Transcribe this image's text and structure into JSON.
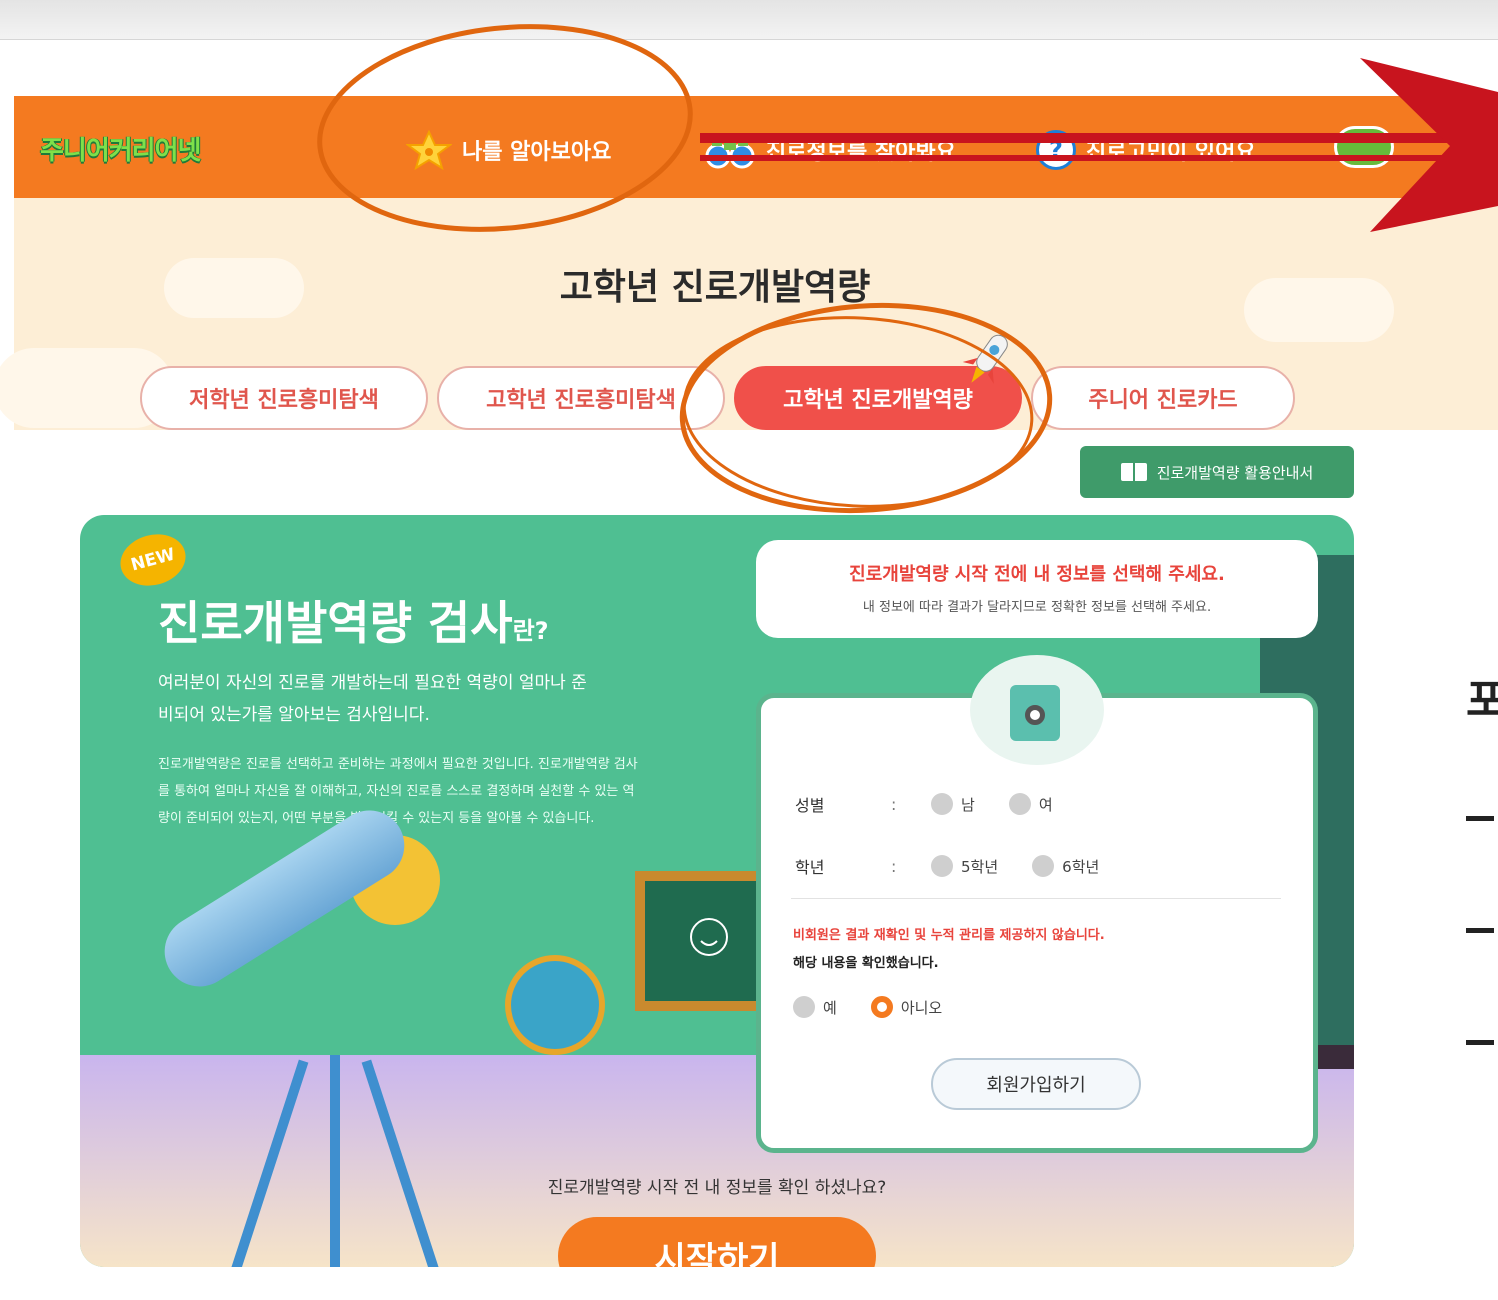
{
  "nav": {
    "logo": "주니어커리어넷",
    "items": [
      {
        "label": "나를 알아보아요",
        "icon": "star-icon"
      },
      {
        "label": "진로정보를 찾아봐요",
        "icon": "binoculars-icon"
      },
      {
        "label": "진로고민이 있어요",
        "icon": "question-icon",
        "icon_text": "?"
      }
    ]
  },
  "page_title": "고학년 진로개발역량",
  "tabs": [
    {
      "label": "저학년 진로흥미탐색",
      "active": false
    },
    {
      "label": "고학년 진로흥미탐색",
      "active": false
    },
    {
      "label": "고학년 진로개발역량",
      "active": true
    },
    {
      "label": "주니어 진로카드",
      "active": false
    }
  ],
  "guide_button": "진로개발역량 활용안내서",
  "intro": {
    "badge": "NEW",
    "title": "진로개발역량 검사",
    "title_suffix": "란?",
    "lead": "여러분이 자신의 진로를 개발하는데 필요한 역량이 얼마나 준비되어 있는가를 알아보는 검사입니다.",
    "body": "진로개발역량은 진로를 선택하고 준비하는 과정에서 필요한 것입니다. 진로개발역량 검사를 통하여 얼마나 자신을 잘 이해하고, 자신의 진로를 스스로 결정하며 실천할 수 있는 역량이 준비되어 있는지, 어떤 부분을 발전시킬 수 있는지 등을 알아볼 수 있습니다."
  },
  "speech": {
    "headline": "진로개발역량 시작 전에 내 정보를 선택해 주세요.",
    "sub": "내 정보에 따라 결과가 달라지므로 정확한 정보를 선택해 주세요."
  },
  "form": {
    "gender_label": "성별",
    "gender_options": [
      "남",
      "여"
    ],
    "grade_label": "학년",
    "grade_options": [
      "5학년",
      "6학년"
    ],
    "colon": ":",
    "warning": "비회원은 결과 재확인 및 누적 관리를 제공하지 않습니다.",
    "confirm_text": "해당 내용을 확인했습니다.",
    "confirm_options": [
      "예",
      "아니오"
    ],
    "confirm_selected": "아니오",
    "join_button": "회원가입하기"
  },
  "question": "진로개발역량 시작 전 내 정보를 확인 하셨나요?",
  "start_button": "시작하기",
  "side": {
    "partial_text": "포"
  },
  "colors": {
    "nav": "#f47a20",
    "active_tab": "#f0504a",
    "panel": "#4fbf92",
    "annotation": "#e0660f",
    "arrow": "#c8141e"
  }
}
